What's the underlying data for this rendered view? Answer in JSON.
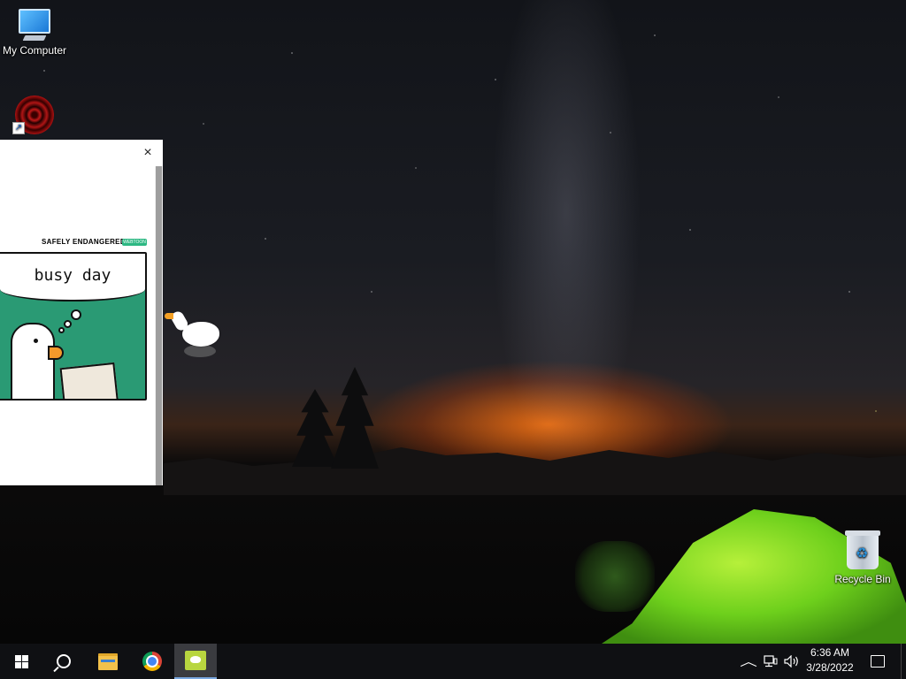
{
  "desktop": {
    "icons": [
      {
        "label": "My Computer",
        "icon": "computer-icon"
      },
      {
        "label": "",
        "icon": "mandala-shortcut-icon"
      },
      {
        "label": "Recycle Bin",
        "icon": "recycle-bin-icon"
      }
    ]
  },
  "popup": {
    "close_glyph": "×",
    "comic": {
      "brand": "SAFELY ENDANGERED",
      "tag": "WEBTOON",
      "title": "busy day"
    }
  },
  "taskbar": {
    "buttons": [
      {
        "name": "start",
        "icon": "windows-logo-icon"
      },
      {
        "name": "search",
        "icon": "search-icon"
      },
      {
        "name": "file-explorer",
        "icon": "folder-icon"
      },
      {
        "name": "chrome",
        "icon": "chrome-icon"
      },
      {
        "name": "desktop-goose",
        "icon": "goose-app-icon",
        "active": true
      }
    ],
    "tray": {
      "chevron": "^",
      "network_icon": "network-icon",
      "volume_icon": "volume-icon"
    },
    "clock": {
      "time": "6:36 AM",
      "date": "3/28/2022"
    },
    "notification_icon": "notification-icon"
  },
  "colors": {
    "taskbar_bg": "#0f1013",
    "comic_green": "#2a9a74",
    "tent_green": "#8fe03a",
    "active_indicator": "#7aa8e0"
  }
}
